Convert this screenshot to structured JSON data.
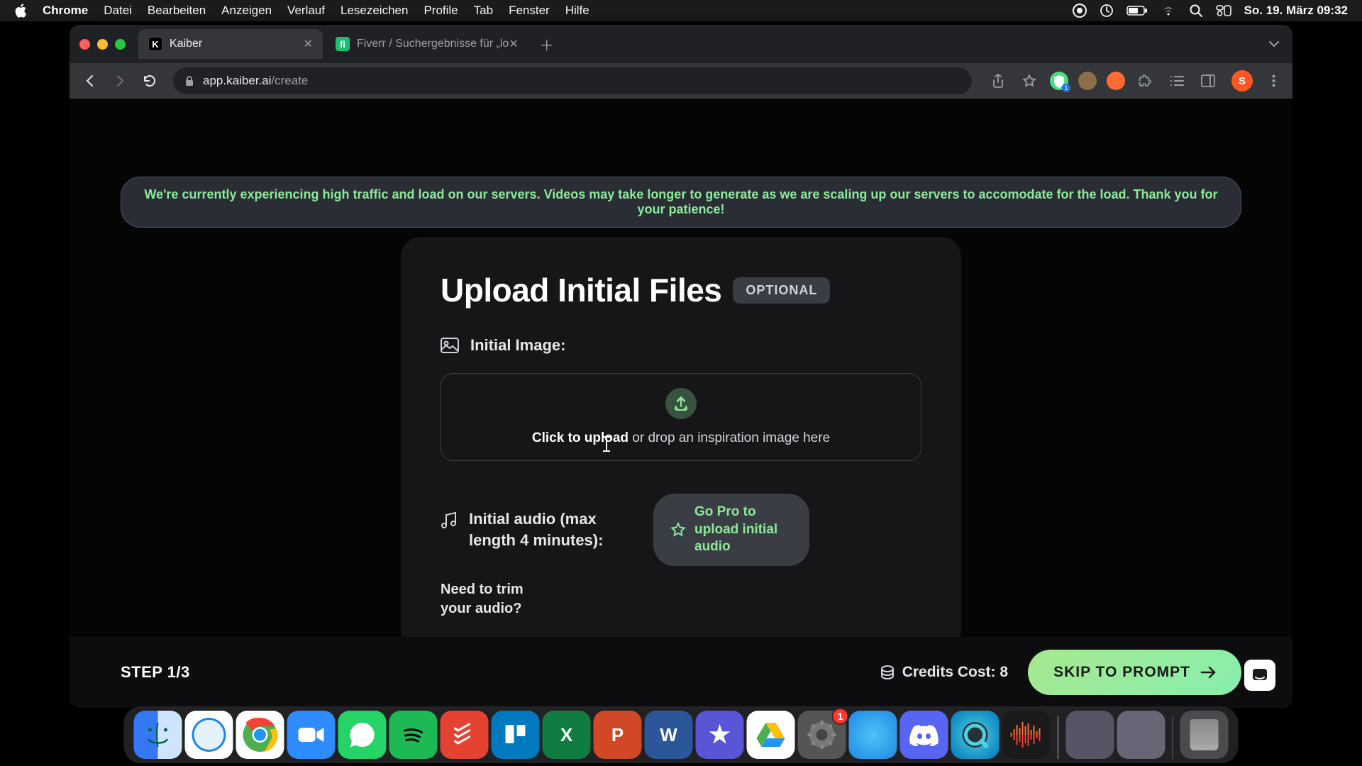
{
  "menubar": {
    "app": "Chrome",
    "items": [
      "Datei",
      "Bearbeiten",
      "Anzeigen",
      "Verlauf",
      "Lesezeichen",
      "Profile",
      "Tab",
      "Fenster",
      "Hilfe"
    ],
    "datetime": "So. 19. März  09:32"
  },
  "browser": {
    "tabs": [
      {
        "title": "Kaiber",
        "favicon": "K",
        "active": true
      },
      {
        "title": "Fiverr / Suchergebnisse für „lo",
        "favicon": "fi",
        "active": false
      }
    ],
    "url_domain": "app.kaiber.ai",
    "url_path": "/create",
    "ext_badge": "1",
    "avatar_letter": "S"
  },
  "page": {
    "notice": "We're currently experiencing high traffic and load on our servers. Videos may take longer to generate as we are scaling up our servers to accomodate for the load. Thank you for your patience!",
    "card": {
      "title": "Upload Initial Files",
      "optional": "OPTIONAL",
      "image_label": "Initial Image:",
      "dropzone_strong": "Click to upload",
      "dropzone_rest": " or drop an inspiration image here",
      "audio_label": "Initial audio (max length 4 minutes):",
      "go_pro": "Go Pro to upload initial audio",
      "trim": "Need to trim your audio?"
    },
    "footer": {
      "step": "STEP 1/3",
      "credits_label": "Credits Cost: ",
      "credits_value": "8",
      "skip": "SKIP TO PROMPT"
    }
  },
  "dock": {
    "settings_badge": "1"
  }
}
